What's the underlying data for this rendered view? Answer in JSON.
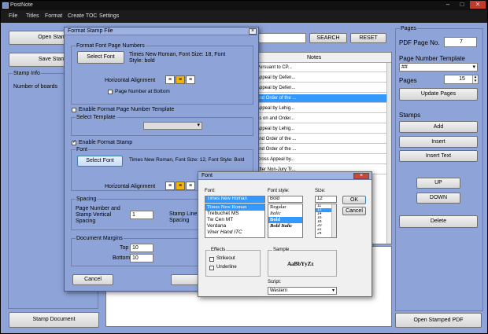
{
  "window": {
    "title": "PostNote"
  },
  "menu": [
    "File",
    "Titles",
    "Format",
    "Create TOC",
    "Settings"
  ],
  "left": {
    "open_stamp": "Open Stam",
    "save_stamp": "Save Stam",
    "stamp_info_title": "Stamp Info",
    "number_of_boards": "Number of boards",
    "stamp_document": "Stamp Document"
  },
  "search": {
    "search_label": "SEARCH",
    "reset_label": "RESET"
  },
  "table": {
    "notes_header": "Notes",
    "rows": [
      "Pursuant to CP...",
      "Appeal by Defen...",
      "Appeal by Defen...",
      "and Order of the ...",
      "Appeal by Lehig...",
      "as on and Order...",
      "Appeal by Lehig...",
      "and Order of the ...",
      "and Order of the ...",
      "Cross Appeal by...",
      "after Non-Jury Tr..."
    ]
  },
  "right": {
    "pages_title": "Pages",
    "pdf_page_no_label": "PDF Page No.",
    "pdf_page_no_value": "7",
    "page_number_template_label": "Page Number Template",
    "template_value": "##",
    "pages_label": "Pages",
    "pages_value": "15",
    "update_pages": "Update Pages",
    "stamps_label": "Stamps",
    "add": "Add",
    "insert": "Insert",
    "insert_text": "Insert Text",
    "up": "UP",
    "down": "DOWN",
    "delete": "Delete",
    "open_stamped_pdf": "Open Stamped PDF"
  },
  "format_dialog": {
    "title": "Format Stamp File",
    "font_page_numbers_title": "Format Font Page Numbers",
    "select_font_1": "Select Font",
    "font_desc_1": "Times New Roman, Font Size: 18, Font Style: bold",
    "horizontal_alignment_1": "Horizontal Alignment",
    "page_number_bottom": "Page Number at Bottom",
    "enable_template": "Enable Format Page Number Template",
    "select_template": "Select Template",
    "enable_format_stamp": "Enable Format Stamp",
    "font_group": "Font",
    "select_font_2": "Select Font",
    "font_desc_2": "Times New Roman, Font Size: 12, Font Style: Bold",
    "horizontal_alignment_2": "Horizontal Alignment",
    "spacing_title": "Spacing",
    "spacing_label": "Page Number and Stamp Vertical Spacing",
    "spacing_value": "1",
    "stamp_line_label": "Stamp Line Spacing",
    "margins_title": "Document Margins",
    "top_label": "Top",
    "top_value": "10",
    "bottom_label": "Bottom",
    "bottom_value": "10",
    "cancel": "Cancel"
  },
  "font_dialog": {
    "title": "Font",
    "font_label": "Font:",
    "font_value": "Times New Roman",
    "style_label": "Font style:",
    "style_value": "Bold",
    "size_label": "Size:",
    "size_value": "12",
    "fonts": [
      "Times New Roman",
      "Trebuchet MS",
      "Tw Cen MT",
      "Verdana",
      "Viner Hand ITC"
    ],
    "styles": [
      "Regular",
      "Italic",
      "Bold",
      "Bold Italic"
    ],
    "sizes": [
      "11",
      "12",
      "14",
      "16",
      "18",
      "20",
      "22",
      "24"
    ],
    "ok": "OK",
    "cancel": "Cancel",
    "effects_title": "Effects",
    "strikeout": "Strikeout",
    "underline": "Underline",
    "sample_title": "Sample",
    "sample_text": "AaBbYyZz",
    "script_label": "Script:",
    "script_value": "Western"
  },
  "colors": {
    "window_bg": "#8ea4d8",
    "selection": "#3399ff",
    "align_active": "#f4b400"
  }
}
